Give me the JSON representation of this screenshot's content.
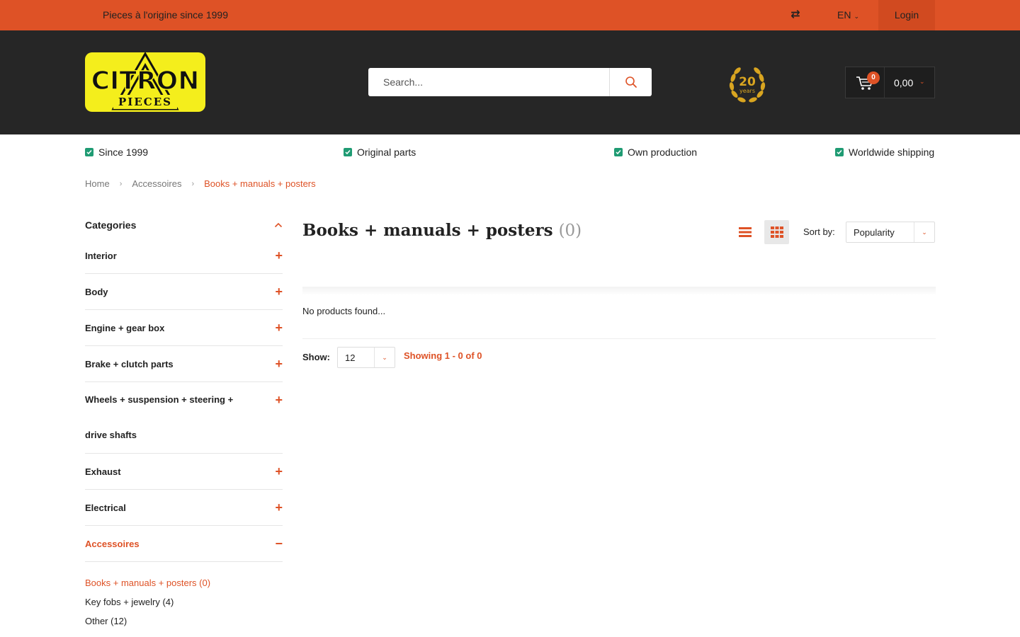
{
  "topbar": {
    "tagline": "Pieces à l'origine since 1999",
    "language": "EN",
    "login_label": "Login"
  },
  "header": {
    "logo_text": "CITRON",
    "logo_subtext": "PIECES",
    "search_placeholder": "Search...",
    "anniversary_number": "20",
    "anniversary_label": "years",
    "cart_count": "0",
    "cart_total": "0,00"
  },
  "usps": [
    {
      "label": "Since 1999"
    },
    {
      "label": "Original parts"
    },
    {
      "label": "Own production"
    },
    {
      "label": "Worldwide shipping"
    }
  ],
  "breadcrumb": {
    "home": "Home",
    "parent": "Accessoires",
    "current": "Books + manuals + posters"
  },
  "sidebar": {
    "heading": "Categories",
    "categories": [
      {
        "label": "Interior"
      },
      {
        "label": "Body"
      },
      {
        "label": "Engine + gear box"
      },
      {
        "label": "Brake + clutch parts"
      },
      {
        "label": "Wheels + suspension + steering +"
      },
      {
        "label": "drive shafts"
      },
      {
        "label": "Exhaust"
      },
      {
        "label": "Electrical"
      },
      {
        "label": "Accessoires"
      }
    ],
    "subcategories": [
      {
        "label": "Books + manuals + posters (0)"
      },
      {
        "label": "Key fobs + jewelry (4)"
      },
      {
        "label": "Other (12)"
      }
    ]
  },
  "main": {
    "title": "Books + manuals + posters",
    "title_count": "(0)",
    "sort_label": "Sort by:",
    "sort_value": "Popularity",
    "empty_message": "No products found...",
    "show_label": "Show:",
    "show_value": "12",
    "showing_text": "Showing 1 - 0 of 0"
  },
  "colors": {
    "accent": "#de5226",
    "header_bg": "#262626",
    "check_green": "#1f9b73",
    "logo_yellow": "#f4ee1c"
  }
}
